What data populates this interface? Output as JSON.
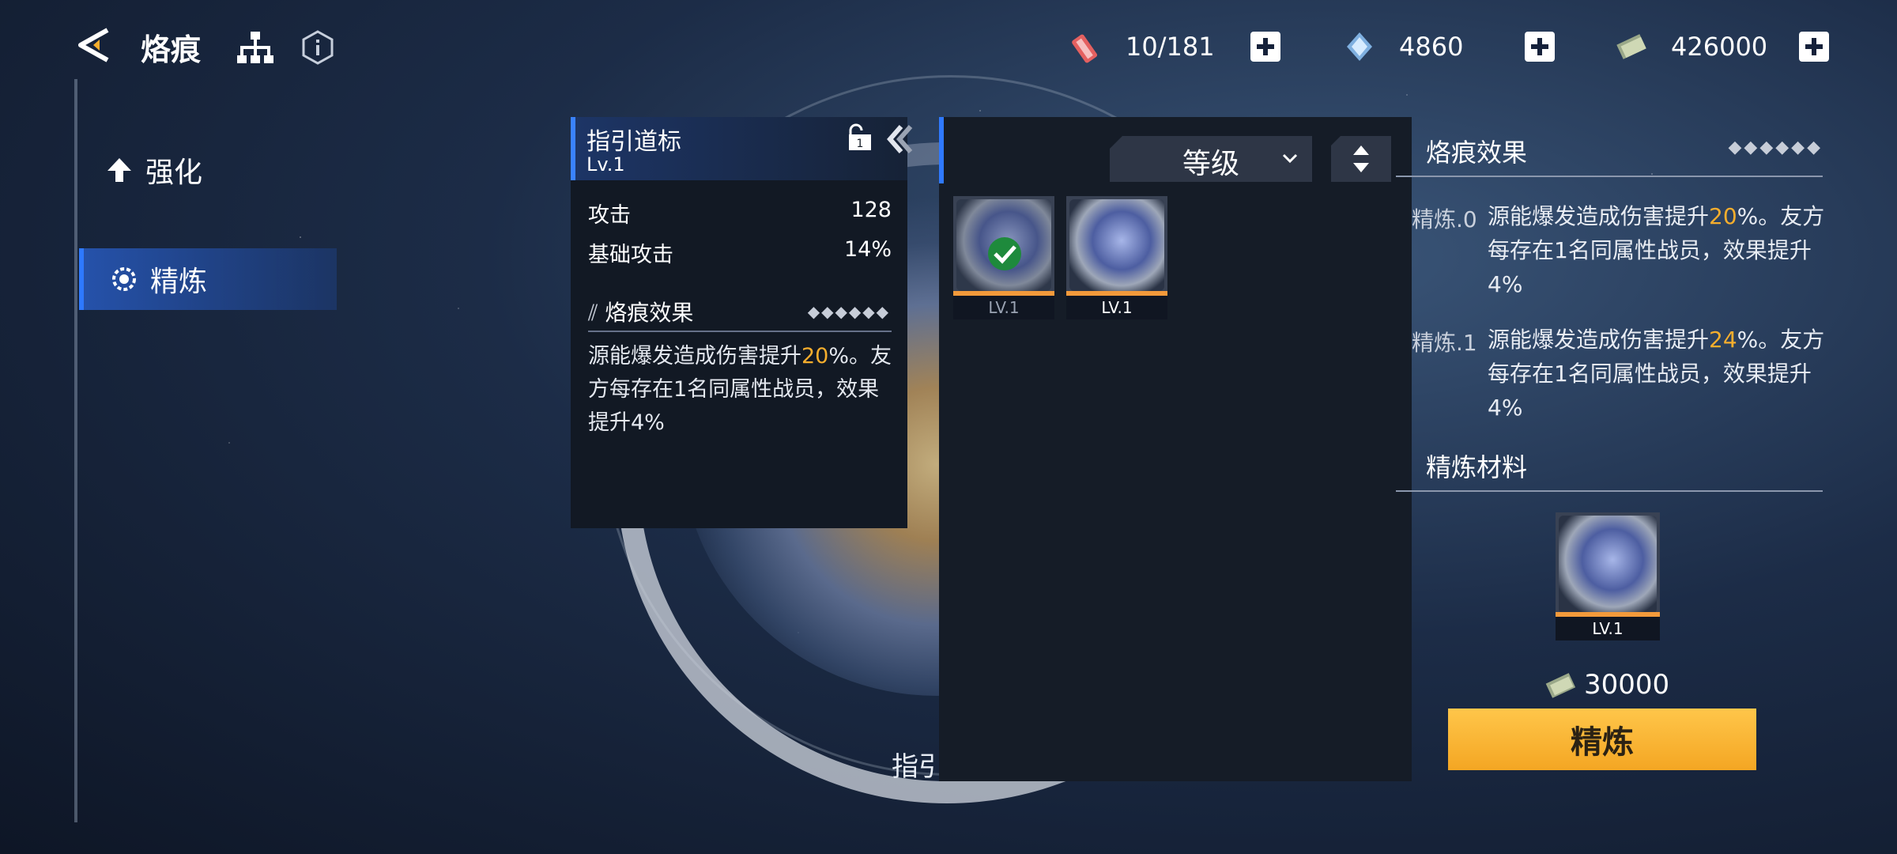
{
  "header": {
    "title": "烙痕",
    "resources": [
      {
        "icon": "stamina-ticket-icon",
        "value": "10/181"
      },
      {
        "icon": "crystal-gem-icon",
        "value": "4860"
      },
      {
        "icon": "cash-icon",
        "value": "426000"
      }
    ]
  },
  "menu": {
    "items": [
      {
        "icon": "arrow-up-icon",
        "label": "强化"
      },
      {
        "icon": "gear-icon",
        "label": "精炼"
      }
    ]
  },
  "item_card": {
    "name": "指引道标",
    "level": "Lv.1",
    "stats": [
      {
        "label": "攻击",
        "value": "128"
      },
      {
        "label": "基础攻击",
        "value": "14%"
      }
    ],
    "effect_title": "烙痕效果",
    "effect_rank": "◆◆◆◆◆◆",
    "effect_pre": "源能爆发造成伤害提升",
    "effect_hl": "20",
    "effect_post": "%。友方每存在1名同属性战员，效果提升4%"
  },
  "inventory": {
    "sort_label": "等级",
    "items": [
      {
        "level": "LV.1",
        "selected": true
      },
      {
        "level": "LV.1",
        "selected": false
      }
    ]
  },
  "center": {
    "name": "指引道标"
  },
  "refine": {
    "effect_title": "烙痕效果",
    "effect_rank": "◆◆◆◆◆◆",
    "levels": [
      {
        "label": "精炼.0",
        "pre": "源能爆发造成伤害提升",
        "hl": "20",
        "post": "%。友方每存在1名同属性战员，效果提升4%"
      },
      {
        "label": "精炼.1",
        "pre": "源能爆发造成伤害提升",
        "hl": "24",
        "post": "%。友方每存在1名同属性战员，效果提升4%"
      }
    ],
    "materials_title": "精炼材料",
    "material_level": "LV.1",
    "cost": "30000",
    "button_label": "精炼"
  },
  "colors": {
    "accent": "#2e79ff",
    "highlight": "#f6ae2d",
    "button": "#f4a623"
  }
}
